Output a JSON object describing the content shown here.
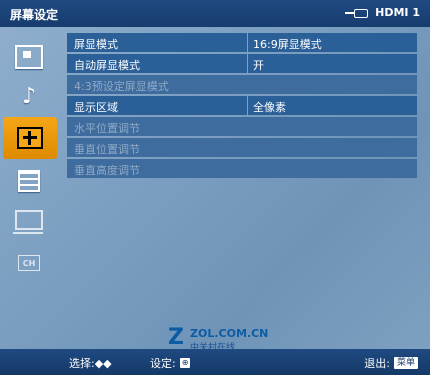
{
  "header": {
    "title": "屏幕设定",
    "input_label": "HDMI 1",
    "input_icon": "hdmi-input-icon"
  },
  "sidebar": {
    "items": [
      {
        "name": "picture",
        "icon": "picture-icon"
      },
      {
        "name": "sound",
        "icon": "music-note-icon",
        "glyph": "♪"
      },
      {
        "name": "screen",
        "icon": "screen-adjust-icon",
        "active": true
      },
      {
        "name": "setup",
        "icon": "settings-list-icon"
      },
      {
        "name": "pc",
        "icon": "monitor-icon"
      },
      {
        "name": "channel",
        "icon": "channel-icon",
        "glyph": "CH"
      }
    ]
  },
  "menu": {
    "rows": [
      {
        "label": "屏显模式",
        "value": "16:9屏显模式",
        "enabled": true
      },
      {
        "label": "自动屏显模式",
        "value": "开",
        "enabled": true
      },
      {
        "label": "4:3预设定屏显模式",
        "value": "",
        "enabled": false
      },
      {
        "label": "显示区域",
        "value": "全像素",
        "enabled": true
      },
      {
        "label": "水平位置调节",
        "value": "",
        "enabled": false
      },
      {
        "label": "垂直位置调节",
        "value": "",
        "enabled": false
      },
      {
        "label": "垂直高度调节",
        "value": "",
        "enabled": false
      }
    ]
  },
  "watermark": {
    "logo": "Z",
    "text": "ZOL.COM.CN",
    "subtext": "中关村在线"
  },
  "footer": {
    "select_label": "选择:",
    "select_arrows": "◆◆",
    "set_label": "设定:",
    "set_key": "⊕",
    "exit_label": "退出:",
    "exit_key": "菜单"
  },
  "colors": {
    "accent": "#f5a616",
    "header_bg": "#1f4a82",
    "row_bg": "#2b5f98",
    "panel_bg": "#7e9fbf"
  }
}
